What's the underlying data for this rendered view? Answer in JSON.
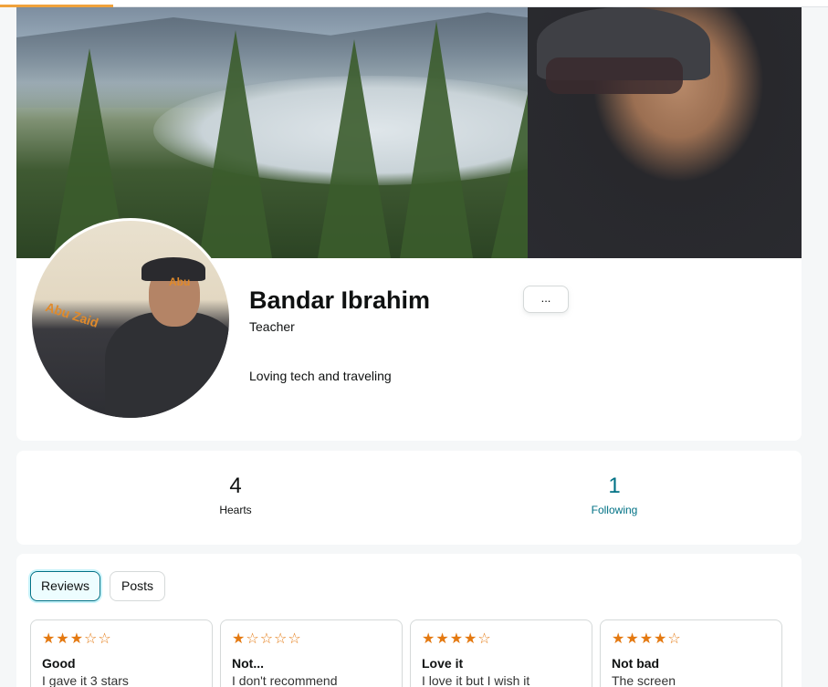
{
  "profile": {
    "name": "Bandar Ibrahim",
    "job": "Teacher",
    "bio": "Loving tech and traveling",
    "more_label": "...",
    "avatar_wall_text": "Abu Zaid",
    "avatar_wall_text_2": "Abu"
  },
  "stats": {
    "hearts": {
      "value": "4",
      "label": "Hearts"
    },
    "following": {
      "value": "1",
      "label": "Following"
    }
  },
  "tabs": [
    {
      "label": "Reviews",
      "active": true
    },
    {
      "label": "Posts",
      "active": false
    }
  ],
  "reviews": [
    {
      "rating": 3,
      "title": "Good",
      "body": "I gave it 3 stars"
    },
    {
      "rating": 1,
      "title": "Not...",
      "body": "I don't recommend"
    },
    {
      "rating": 4,
      "title": "Love it",
      "body": "I love it but I wish it"
    },
    {
      "rating": 4,
      "title": "Not bad",
      "body": "The screen"
    }
  ],
  "colors": {
    "accent_teal": "#007185",
    "star": "#e47911",
    "progress": "#f0a23c"
  },
  "icons": {
    "star_filled": "★",
    "star_empty": "☆"
  }
}
